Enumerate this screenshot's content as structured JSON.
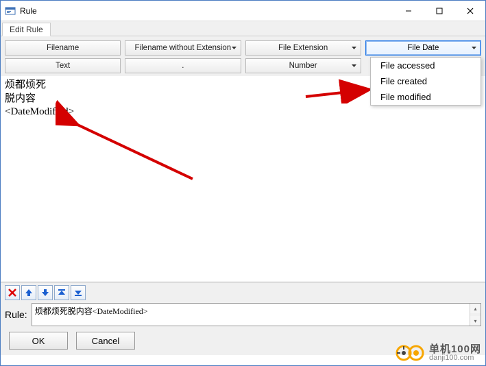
{
  "window": {
    "title": "Rule"
  },
  "tabs": {
    "edit_rule": "Edit Rule"
  },
  "toolbar": {
    "row1": {
      "filename": "Filename",
      "filename_no_ext": "Filename without Extension",
      "file_extension": "File Extension",
      "file_date": "File Date"
    },
    "row2": {
      "text": "Text",
      "dot": ".",
      "number": "Number"
    }
  },
  "dropdown": {
    "items": [
      "File accessed",
      "File created",
      "File modified"
    ]
  },
  "editor": {
    "line1": "烦都烦死",
    "line2": "脱内容",
    "line3": "<DateModified>"
  },
  "rule": {
    "label": "Rule:",
    "value": "烦都烦死脱内容<DateModified>"
  },
  "buttons": {
    "ok": "OK",
    "cancel": "Cancel"
  },
  "watermark": {
    "line1": "单机100网",
    "line2": "danji100.com"
  }
}
